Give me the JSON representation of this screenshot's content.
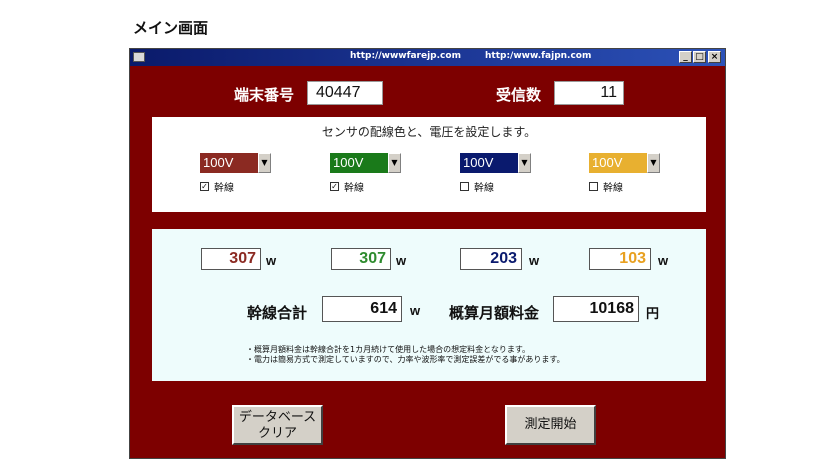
{
  "page": {
    "title": "メイン画面"
  },
  "window": {
    "url1": "http://wwwfarejp.com",
    "url2": "http:/www.fajpn.com",
    "buttons": {
      "minimize": "_",
      "maximize": "□",
      "close": "×"
    }
  },
  "header": {
    "terminal_label": "端末番号",
    "terminal_value": "40447",
    "received_label": "受信数",
    "received_value": "11"
  },
  "sensor_panel": {
    "prompt": "センサの配線色と、電圧を設定します。",
    "sensors": [
      {
        "voltage": "100V",
        "color": "#8b2a22",
        "checked": true,
        "check_mark": "✓",
        "label": "幹線"
      },
      {
        "voltage": "100V",
        "color": "#1a7a1a",
        "checked": true,
        "check_mark": "✓",
        "label": "幹線"
      },
      {
        "voltage": "100V",
        "color": "#0a1a6e",
        "checked": false,
        "check_mark": "",
        "label": "幹線"
      },
      {
        "voltage": "100V",
        "color": "#e8b030",
        "checked": false,
        "check_mark": "",
        "label": "幹線"
      }
    ]
  },
  "readings": {
    "values": [
      {
        "value": "307",
        "unit": "w",
        "color": "#8b2a22"
      },
      {
        "value": "307",
        "unit": "w",
        "color": "#2e8b2e"
      },
      {
        "value": "203",
        "unit": "w",
        "color": "#0a1a6e"
      },
      {
        "value": "103",
        "unit": "w",
        "color": "#e8a020"
      }
    ],
    "total_label": "幹線合計",
    "total_value": "614",
    "total_unit": "w",
    "estimate_label": "概算月額料金",
    "estimate_value": "10168",
    "estimate_unit": "円",
    "notes": [
      "・概算月額料金は幹線合計を1カ月続けて使用した場合の想定料金となります。",
      "・電力は簡易方式で測定していますので、力率や波形率で測定誤差がでる事があります。"
    ]
  },
  "actions": {
    "clear_db_line1": "データベース",
    "clear_db_line2": "クリア",
    "start_measure": "測定開始"
  }
}
